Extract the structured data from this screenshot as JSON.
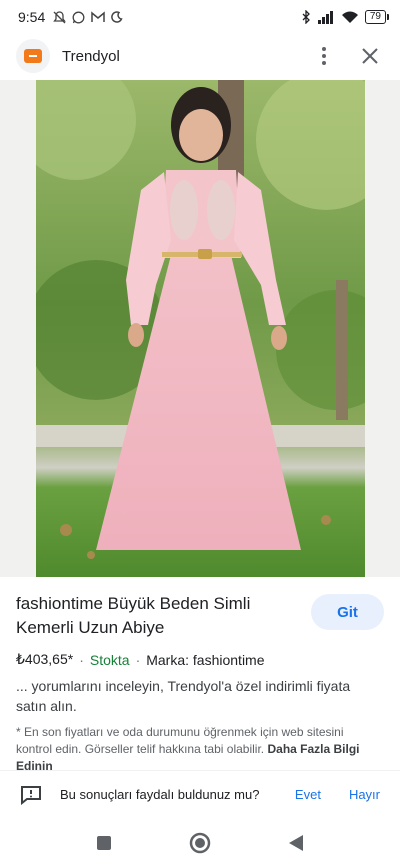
{
  "status_bar": {
    "time": "9:54",
    "battery": "79",
    "left_icons": [
      "mute-icon",
      "whatsapp-icon",
      "gmail-icon",
      "moon-icon"
    ],
    "right_icons": [
      "bluetooth-icon",
      "signal-icon",
      "wifi-icon",
      "battery-icon"
    ]
  },
  "header": {
    "site_name": "Trendyol",
    "logo_text": "trendyol"
  },
  "product": {
    "title": "fashiontime Büyük Beden Simli Kemerli Uzun Abiye",
    "visit_label": "Git",
    "price": "₺403,65*",
    "dot1": "·",
    "stock": "Stokta",
    "dot2": "·",
    "brand": "Marka: fashiontime",
    "snippet": "... yorumlarını inceleyin, Trendyol'a özel indirimli fiyata satın alın.",
    "disclaimer": "* En son fiyatları ve oda durumunu öğrenmek için web sitesini kontrol edin. Görseller telif hakkına tabi olabilir.",
    "learn_more": "Daha Fazla Bilgi Edinin"
  },
  "feedback": {
    "question": "Bu sonuçları faydalı buldunuz mu?",
    "yes": "Evet",
    "no": "Hayır"
  },
  "colors": {
    "accent": "#1a73e8",
    "stock_green": "#188038",
    "dress_pink": "#f2b8c2",
    "brand_orange": "#f27a1a"
  }
}
